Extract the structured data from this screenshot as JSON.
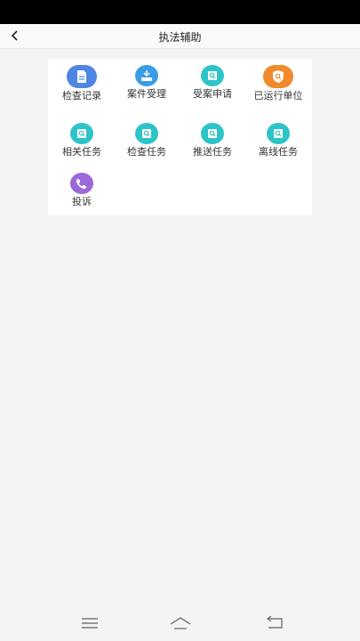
{
  "header": {
    "title": "执法辅助",
    "back_icon": "chevron-left-icon"
  },
  "grid": {
    "items": [
      {
        "label": "检查记录",
        "icon": "document-icon",
        "color": "#4e86e4"
      },
      {
        "label": "案件受理",
        "icon": "inbox-tray-icon",
        "color": "#3a9ee6"
      },
      {
        "label": "受案申请",
        "icon": "search-doc-icon",
        "color": "#2cc3c9"
      },
      {
        "label": "已运行单位",
        "icon": "shield-search-icon",
        "color": "#f08a2c"
      },
      {
        "label": "相关任务",
        "icon": "search-doc-icon",
        "color": "#2cc3c9"
      },
      {
        "label": "检查任务",
        "icon": "search-doc-icon",
        "color": "#2cc3c9"
      },
      {
        "label": "推送任务",
        "icon": "search-doc-icon",
        "color": "#2cc3c9"
      },
      {
        "label": "离线任务",
        "icon": "search-doc-icon",
        "color": "#2cc3c9"
      },
      {
        "label": "投诉",
        "icon": "phone-icon",
        "color": "#9b6ad8"
      }
    ]
  },
  "nav": {
    "menu_icon": "menu-icon",
    "home_icon": "home-icon",
    "back_icon": "back-icon"
  }
}
